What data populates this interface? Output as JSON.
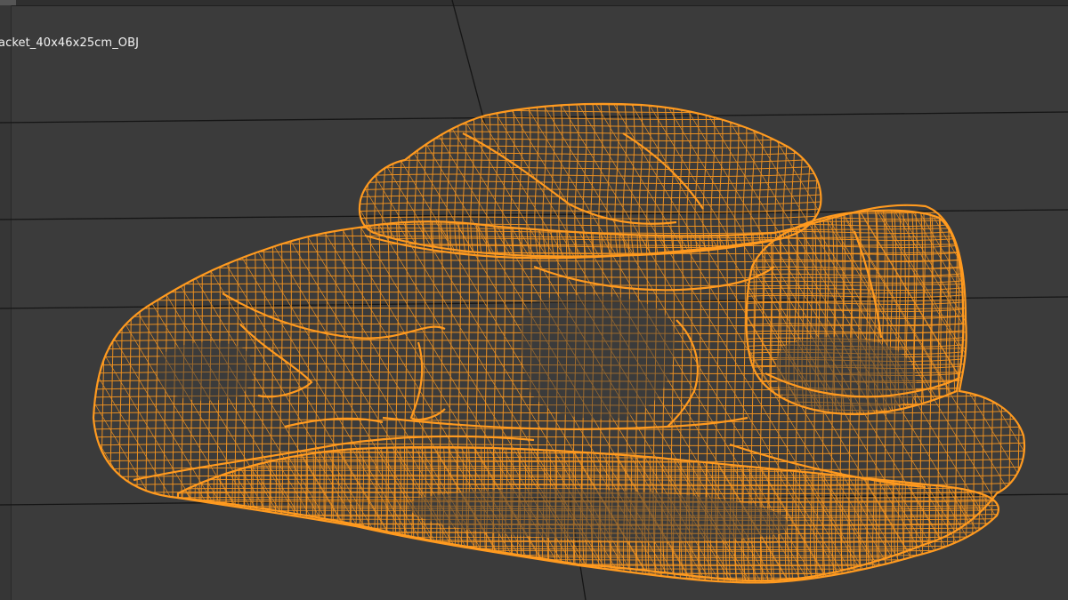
{
  "viewport": {
    "object_label": "acket_40x46x25cm_OBJ",
    "display_mode": "wireframe",
    "background_color": "#3b3b3b",
    "grid_color": "#151515",
    "wireframe_color": "#ff9a1f"
  }
}
